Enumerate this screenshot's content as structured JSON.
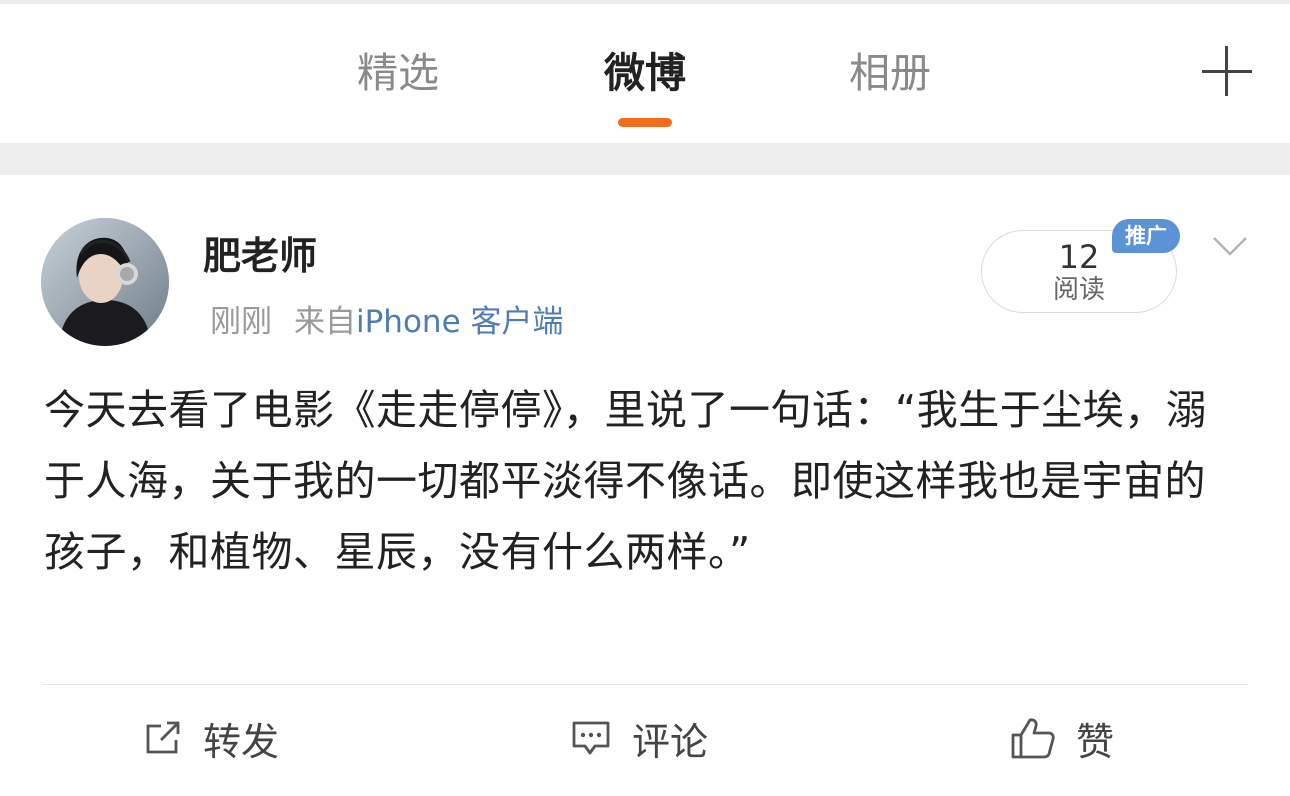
{
  "tabs": [
    {
      "label": "精选",
      "active": false
    },
    {
      "label": "微博",
      "active": true
    },
    {
      "label": "相册",
      "active": false
    }
  ],
  "accent_color": "#f06e1e",
  "plus_icon": "plus-icon",
  "post": {
    "username": "肥老师",
    "time": "刚刚",
    "source_prefix": "来自",
    "source_client": "iPhone 客户端",
    "reads": {
      "count": "12",
      "label": "阅读"
    },
    "promo_badge": "推广",
    "text": "今天去看了电影《走走停停》，里说了一句话：“我生于尘埃，溺于人海，关于我的一切都平淡得不像话。即使这样我也是宇宙的孩子，和植物、星辰，没有什么两样。”"
  },
  "actions": {
    "repost": {
      "label": "转发",
      "icon": "repost-icon"
    },
    "comment": {
      "label": "评论",
      "icon": "comment-icon"
    },
    "like": {
      "label": "赞",
      "icon": "thumbs-up-icon"
    }
  }
}
